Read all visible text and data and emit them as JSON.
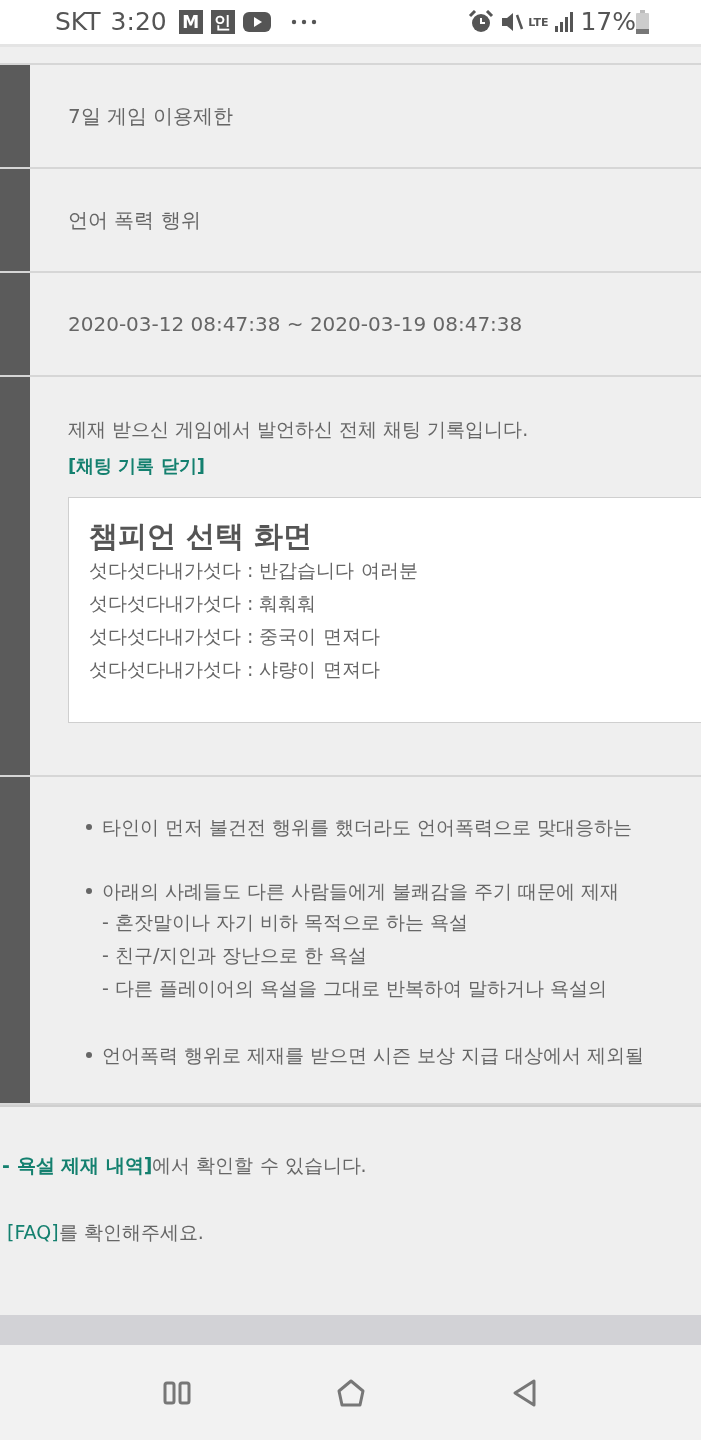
{
  "status_bar": {
    "carrier": "SKT",
    "time": "3:20",
    "notification_badges": [
      "M",
      "인"
    ],
    "network": "LTE",
    "battery": "17%"
  },
  "rows": [
    {
      "kind": "text",
      "text": "7일 게임 이용제한"
    },
    {
      "kind": "text",
      "text": "언어 폭력 행위"
    },
    {
      "kind": "text",
      "text": "2020-03-12 08:47:38 ~ 2020-03-19 08:47:38"
    },
    {
      "kind": "chat",
      "intro": "제재 받으신 게임에서 발언하신 전체 채팅 기록입니다.",
      "toggle_link": "[채팅 기록 닫기]",
      "chat_log": {
        "title": "챔피언 선택 화면",
        "messages": [
          "섯다섯다내가섯다 : 반갑습니다 여러분",
          "섯다섯다내가섯다 : 훠훠훠",
          "섯다섯다내가섯다 : 중국이 면져다",
          "섯다섯다내가섯다 : 샤량이 면져다"
        ]
      }
    },
    {
      "kind": "notice",
      "bullets": [
        {
          "text": "타인이 먼저 불건전 행위를 했더라도 언어폭력으로 맞대응하는"
        },
        {
          "text": "아래의 사례들도 다른 사람들에게 불쾌감을 주기 때문에 제재",
          "sub_items": [
            "- 혼잣말이나 자기 비하 목적으로 하는 욕설",
            "- 친구/지인과 장난으로 한 욕설",
            "- 다른 플레이어의 욕설을 그대로 반복하여 말하거나 욕설의"
          ]
        },
        {
          "text": "언어폭력 행위로 제재를 받으면 시즌 보상 지급 대상에서 제외될"
        }
      ]
    }
  ],
  "footer": {
    "lines": [
      {
        "link": "- 욕설 제재 내역]",
        "text": "에서 확인할 수 있습니다."
      },
      {
        "link": "[FAQ]",
        "text": "를 확인해주세요."
      }
    ]
  }
}
